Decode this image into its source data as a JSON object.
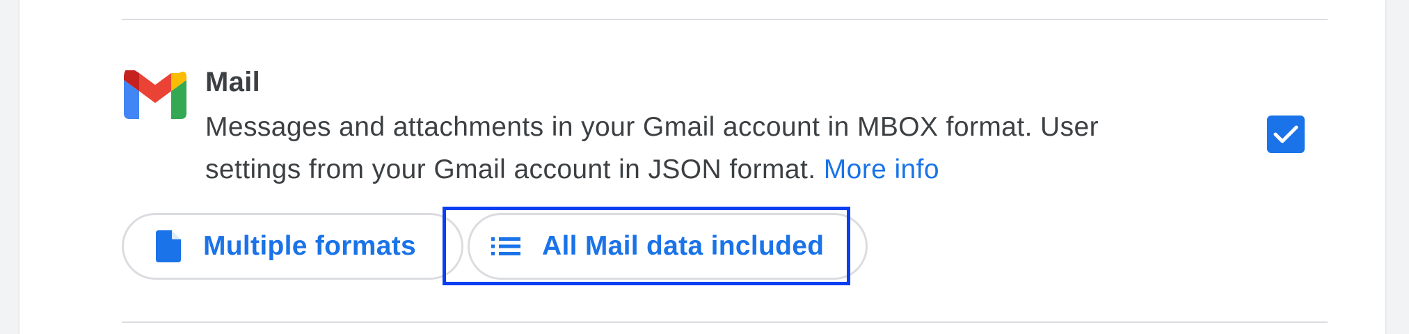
{
  "product": {
    "title": "Mail",
    "description": "Messages and attachments in your Gmail account in MBOX format. User settings from your Gmail account in JSON format.",
    "more_info": "More info",
    "logo_icon": "gmail-logo-icon",
    "selected": true
  },
  "chips": {
    "formats": {
      "label": "Multiple formats",
      "icon": "document-icon"
    },
    "data": {
      "label": "All Mail data included",
      "icon": "list-icon"
    }
  },
  "colors": {
    "accent": "#1a73e8",
    "text": "#3c4043",
    "border": "#dadce0",
    "highlight": "#0a3ef2"
  }
}
